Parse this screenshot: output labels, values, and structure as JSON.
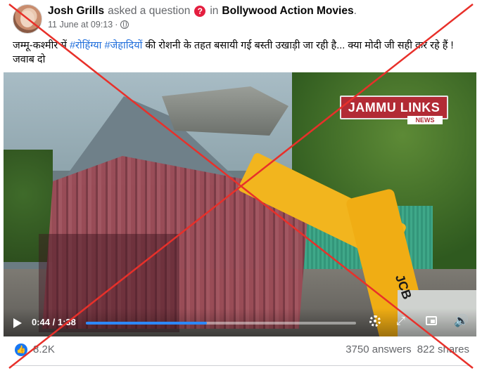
{
  "header": {
    "author": "Josh Grills",
    "action": "asked a question",
    "preposition": "in",
    "group": "Bollywood Action Movies",
    "group_suffix": ".",
    "timestamp": "11 June at 09:13",
    "separator": "·",
    "question_icon": "question-mark-icon",
    "privacy_icon": "globe-icon"
  },
  "post": {
    "text_part1": "जम्मू-कश्मीर में ",
    "hashtag1": "#रोहिंग्या",
    "text_part2": " ",
    "hashtag2": "#जेहादियों",
    "text_part3": " की रोशनी के तहत बसायी गई बस्ती उखाड़ी जा रही है... क्या मोदी जी सही कर रहे हैं ! जवाब दो"
  },
  "video": {
    "channel_logo": "JAMMU LINKS",
    "channel_sub": "NEWS",
    "current_time": "0:44",
    "time_separator": " / ",
    "duration": "1:38",
    "progress_fraction": 0.449,
    "machine_label": "JCB"
  },
  "footer": {
    "reactions": "8.2K",
    "answers": "3750 answers",
    "shares": "822 shares",
    "reaction_icon": "thumbs-up-icon"
  },
  "colors": {
    "hashtag": "#216fdb",
    "progress": "#2d88ff",
    "cross": "#e8302a",
    "like_badge": "#1877f2"
  }
}
